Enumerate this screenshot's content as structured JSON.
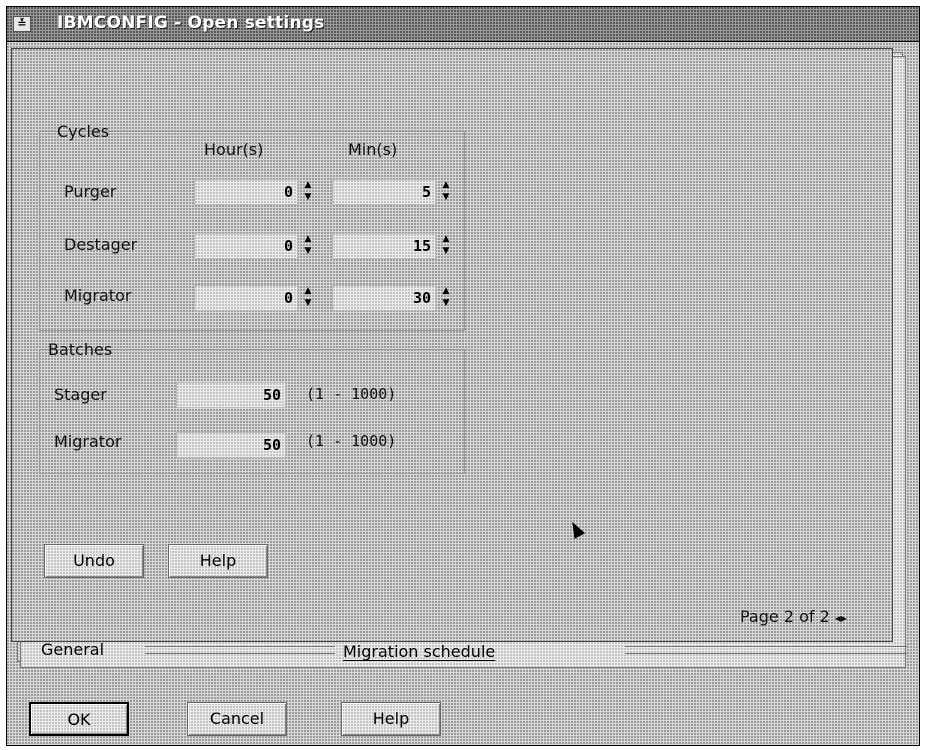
{
  "window": {
    "title": "IBMCONFIG - Open settings",
    "system_menu_glyph": "≚"
  },
  "cycles": {
    "group_label": "Cycles",
    "col_hours": "Hour(s)",
    "col_mins": "Min(s)",
    "rows": [
      {
        "label": "Purger",
        "hours": "0",
        "mins": "5"
      },
      {
        "label": "Destager",
        "hours": "0",
        "mins": "15"
      },
      {
        "label": "Migrator",
        "hours": "0",
        "mins": "30"
      }
    ]
  },
  "batches": {
    "group_label": "Batches",
    "rows": [
      {
        "label": "Stager",
        "value": "50",
        "range": "(1 - 1000)"
      },
      {
        "label": "Migrator",
        "value": "50",
        "range": "(1 - 1000)"
      }
    ]
  },
  "page_buttons": {
    "undo": "Undo",
    "help": "Help"
  },
  "notebook": {
    "page_indicator": "Page 2 of 2",
    "tabs": [
      "General",
      "Migration schedule"
    ]
  },
  "dialog_buttons": {
    "ok": "OK",
    "cancel": "Cancel",
    "help": "Help"
  },
  "icons": {
    "spin_up": "▲",
    "spin_down": "▼",
    "page_prev": "◂",
    "page_next": "▸"
  }
}
